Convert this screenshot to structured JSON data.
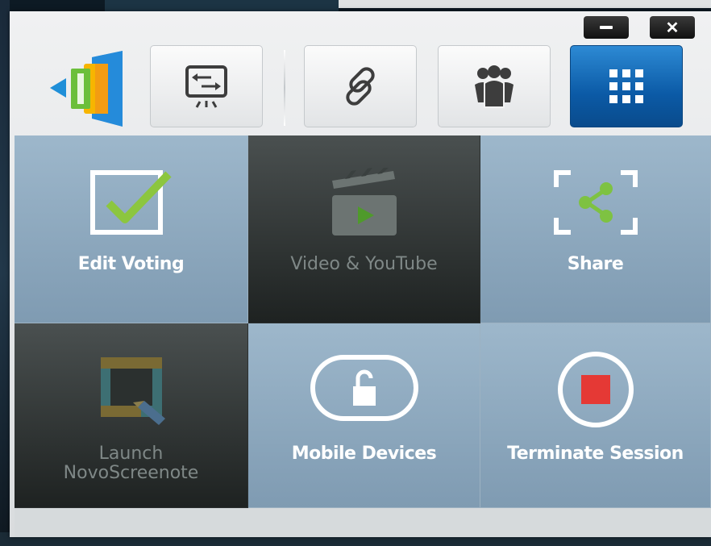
{
  "window": {
    "controls": {
      "minimize_icon": "minimize-icon",
      "close_label": "✕"
    }
  },
  "toolbar": {
    "logo_icon": "novo-logo",
    "buttons": [
      {
        "name": "screen-share-icon"
      },
      {
        "name": "link-icon"
      },
      {
        "name": "users-icon"
      },
      {
        "name": "grid-menu-icon",
        "active": true
      }
    ]
  },
  "tiles": [
    {
      "label": "Edit Voting",
      "icon": "checkbox-check-icon",
      "enabled": true
    },
    {
      "label": "Video & YouTube",
      "icon": "clapperboard-icon",
      "enabled": false
    },
    {
      "label": "Share",
      "icon": "share-icon",
      "enabled": true
    },
    {
      "label_line1": "Launch",
      "label_line2": "NovoScreenote",
      "icon": "screenote-icon",
      "enabled": false
    },
    {
      "label": "Mobile Devices",
      "icon": "unlock-icon",
      "enabled": true
    },
    {
      "label": "Terminate Session",
      "icon": "stop-icon",
      "enabled": true
    }
  ],
  "colors": {
    "active_blue": "#0b5aa6",
    "tile_light": "#8ea9be",
    "tile_dark": "#2b302f",
    "check_green": "#8cc63f",
    "share_green": "#7ec242",
    "stop_red": "#e53935"
  }
}
